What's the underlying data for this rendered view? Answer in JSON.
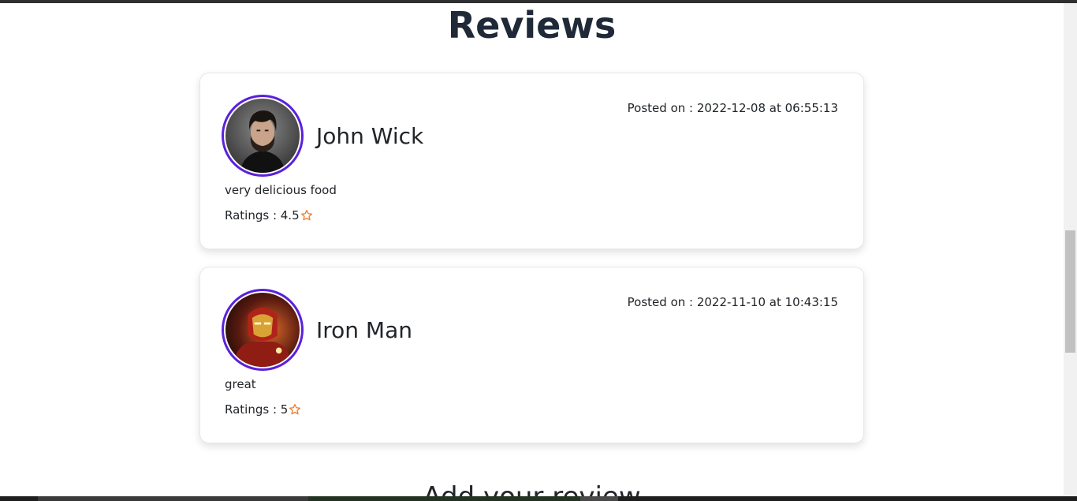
{
  "section": {
    "title": "Reviews",
    "next_heading": "Add your review"
  },
  "reviews": [
    {
      "name": "John Wick",
      "posted": "Posted on : 2022-12-08 at 06:55:13",
      "comment": "very delicious food",
      "ratings": "Ratings : 4.5",
      "avatar_icon": "john-wick-portrait"
    },
    {
      "name": "Iron Man",
      "posted": "Posted on : 2022-11-10 at 10:43:15",
      "comment": "great",
      "ratings": "Ratings : 5",
      "avatar_icon": "iron-man-portrait"
    }
  ],
  "colors": {
    "accent": "#5b21d9",
    "star": "#f07b2b",
    "title": "#1f2937"
  }
}
